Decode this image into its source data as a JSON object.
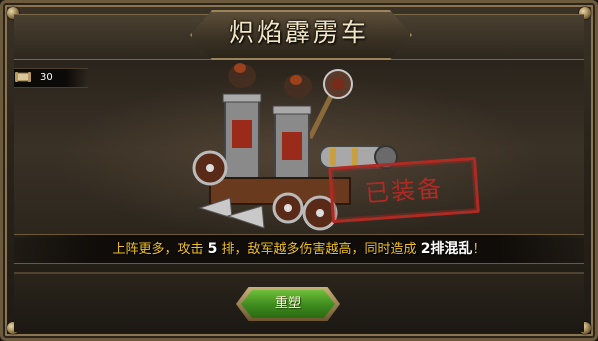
{
  "dialog": {
    "title": "炽焰霹雳车"
  },
  "counter": {
    "value": "30"
  },
  "stamp": {
    "text": "已装备"
  },
  "description": {
    "part1": "上阵更多，攻击 ",
    "num1": "5",
    "part2": " 排，敌军越多伤害越高，同时造成 ",
    "highlight": "2排混乱",
    "part3": "！"
  },
  "actions": {
    "rebuild_label": "重塑"
  },
  "colors": {
    "accent_gold": "#f0c020",
    "stamp_red": "#b02a24",
    "button_green": "#3d8a1e"
  },
  "icons": {
    "counter_icon": "scroll-icon"
  }
}
